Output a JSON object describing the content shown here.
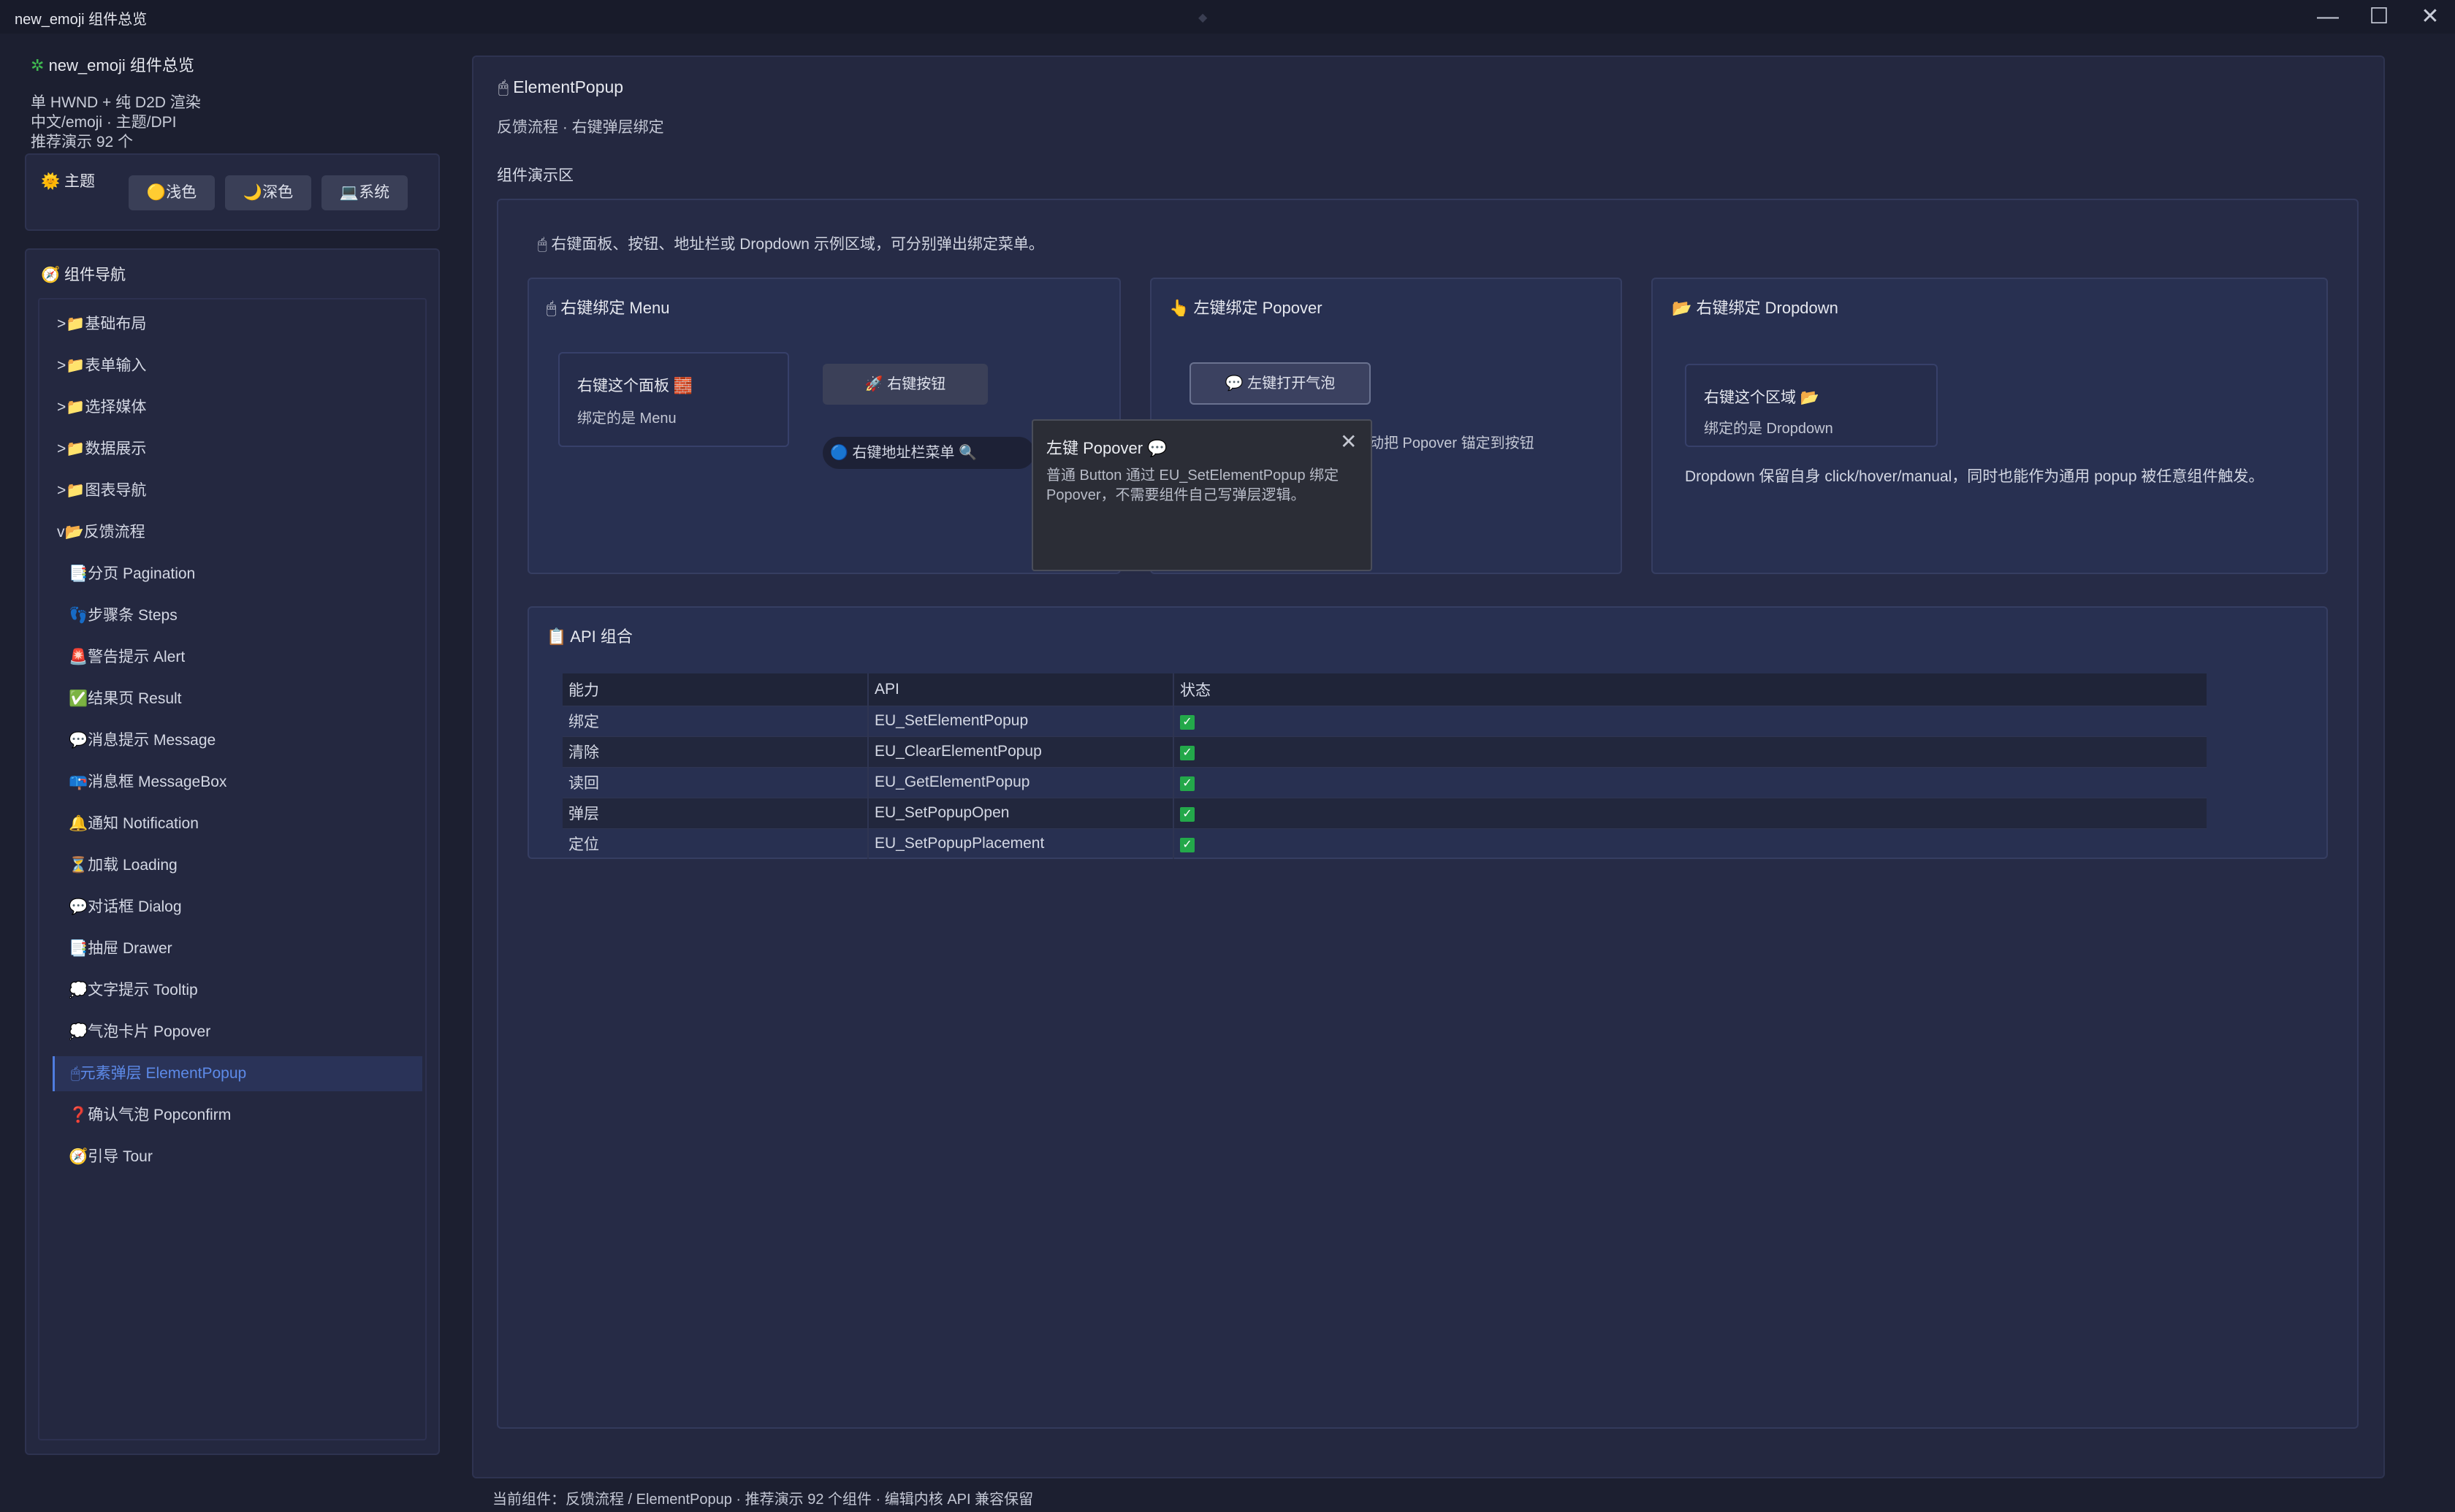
{
  "window": {
    "title": "new_emoji 组件总览",
    "minimize": "—",
    "maximize": "☐",
    "close": "✕"
  },
  "sidebar": {
    "app_title": "new_emoji 组件总览",
    "meta_lines": [
      "单 HWND + 纯 D2D 渲染",
      "中文/emoji · 主题/DPI",
      "推荐演示 92 个"
    ],
    "theme": {
      "label": "主题",
      "buttons": [
        {
          "icon": "🟡",
          "label": "浅色"
        },
        {
          "icon": "🌙",
          "label": "深色"
        },
        {
          "icon": "💻",
          "label": "系统"
        }
      ]
    },
    "nav": {
      "title": "组件导航",
      "groups": [
        {
          "prefix": ">",
          "icon": "📁",
          "label": "基础布局"
        },
        {
          "prefix": ">",
          "icon": "📁",
          "label": "表单输入"
        },
        {
          "prefix": ">",
          "icon": "📁",
          "label": "选择媒体"
        },
        {
          "prefix": ">",
          "icon": "📁",
          "label": "数据展示"
        },
        {
          "prefix": ">",
          "icon": "📁",
          "label": "图表导航"
        },
        {
          "prefix": "v",
          "icon": "📂",
          "label": "反馈流程"
        }
      ],
      "children": [
        {
          "icon": "📑",
          "label": "分页 Pagination"
        },
        {
          "icon": "👣",
          "label": "步骤条 Steps"
        },
        {
          "icon": "🚨",
          "label": "警告提示 Alert"
        },
        {
          "icon": "✅",
          "label": "结果页 Result"
        },
        {
          "icon": "💬",
          "label": "消息提示 Message"
        },
        {
          "icon": "📪",
          "label": "消息框 MessageBox"
        },
        {
          "icon": "🔔",
          "label": "通知 Notification"
        },
        {
          "icon": "⏳",
          "label": "加载 Loading"
        },
        {
          "icon": "💬",
          "label": "对话框 Dialog"
        },
        {
          "icon": "📑",
          "label": "抽屉 Drawer"
        },
        {
          "icon": "💭",
          "label": "文字提示 Tooltip"
        },
        {
          "icon": "💭",
          "label": "气泡卡片 Popover"
        },
        {
          "icon": "🖱",
          "label": "元素弹层 ElementPopup"
        },
        {
          "icon": "❓",
          "label": "确认气泡 Popconfirm"
        },
        {
          "icon": "🧭",
          "label": "引导 Tour"
        }
      ],
      "active_index": 12
    }
  },
  "main": {
    "title_icon": "🖱",
    "title": "ElementPopup",
    "subtitle": "反馈流程 · 右键弹层绑定",
    "demo_label": "组件演示区",
    "demo_hint": "🖱 右键面板、按钮、地址栏或 Dropdown 示例区域，可分别弹出绑定菜单。",
    "menu_card": {
      "title": "🖱 右键绑定 Menu",
      "panel_title": "右键这个面板 🧱",
      "panel_sub": "绑定的是 Menu",
      "button": "🚀 右键按钮",
      "address": "🔵 右键地址栏菜单 🔍"
    },
    "popover_card": {
      "title": "👆 左键绑定 Popover",
      "button": "💬 左键打开气泡",
      "text": "动把 Popover 锚定到按钮"
    },
    "dropdown_card": {
      "title": "📂 右键绑定 Dropdown",
      "panel_title": "右键这个区域 📂",
      "panel_sub": "绑定的是 Dropdown",
      "text": "Dropdown 保留自身 click/hover/manual，同时也能作为通用 popup 被任意组件触发。"
    },
    "popover": {
      "title": "左键 Popover 💬",
      "body": "普通 Button 通过 EU_SetElementPopup 绑定 Popover，不需要组件自己写弹层逻辑。",
      "close": "✕"
    },
    "api": {
      "title": "📋 API 组合",
      "headers": [
        "能力",
        "API",
        "状态"
      ],
      "rows": [
        {
          "cap": "绑定",
          "api": "EU_SetElementPopup",
          "status": "✓"
        },
        {
          "cap": "清除",
          "api": "EU_ClearElementPopup",
          "status": "✓"
        },
        {
          "cap": "读回",
          "api": "EU_GetElementPopup",
          "status": "✓"
        },
        {
          "cap": "弹层",
          "api": "EU_SetPopupOpen",
          "status": "✓"
        },
        {
          "cap": "定位",
          "api": "EU_SetPopupPlacement",
          "status": "✓"
        }
      ]
    }
  },
  "status_bar": "当前组件：反馈流程 / ElementPopup · 推荐演示 92 个组件 · 编辑内核 API 兼容保留",
  "colors": {
    "accent": "#4f7de0",
    "background": "#1c1f30",
    "panel": "#242840",
    "check": "#23a84a"
  }
}
